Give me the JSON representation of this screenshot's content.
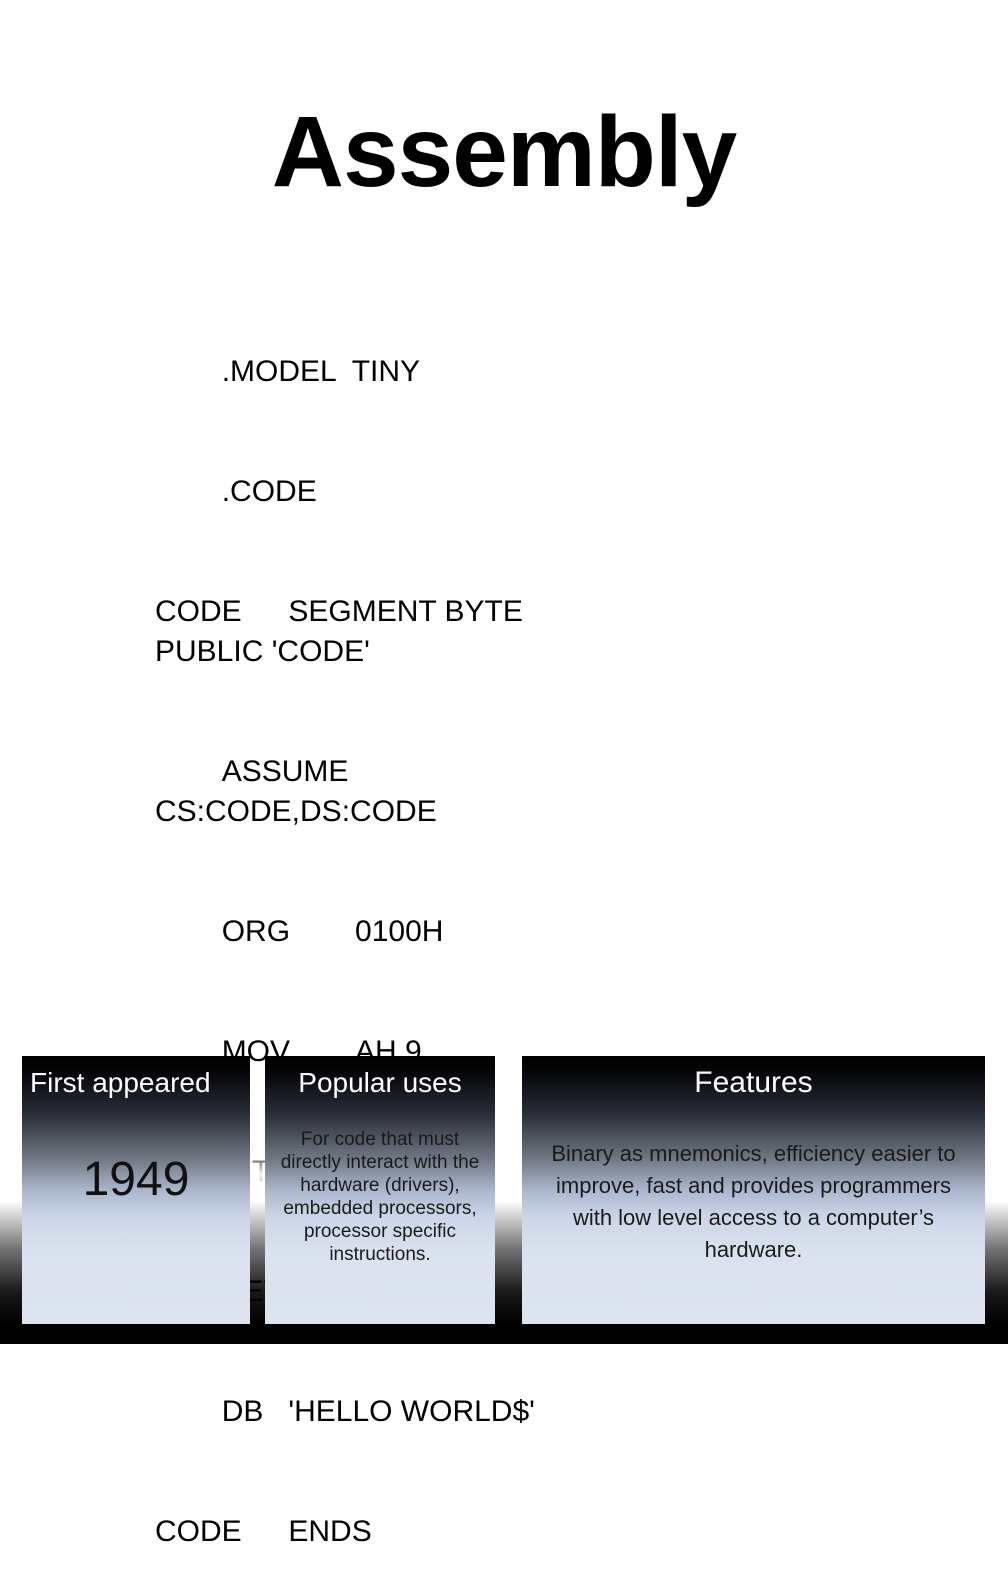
{
  "slide": {
    "title": "Assembly",
    "code_lines": [
      "\t.MODEL  TINY",
      "\t.CODE",
      "CODE\tSEGMENT BYTE PUBLIC 'CODE'",
      "\tASSUME CS:CODE,DS:CODE",
      "\tORG\t0100H",
      "\tMOV\tAH,9",
      "\tINT\t21H",
      "\tRET",
      "\tDB\t'HELLO WORLD$'",
      "CODE\tENDS"
    ],
    "code_text": "          .MODEL  TINY\n          .CODE\nCODE    SEGMENT BYTE PUBLIC 'CODE'\n          ASSUME CS:CODE,DS:CODE\n          ORG    0100H\n          MOV    AH,9\n          INT    21H\n          RET\n          DB    'HELLO WORLD$'\nCODE    ENDS"
  },
  "panels": [
    {
      "header": "First appeared",
      "value": "1949",
      "body": ""
    },
    {
      "header": "Popular uses",
      "value": "",
      "body": "For code that must directly interact with the hardware (drivers), embedded processors, processor specific instructions."
    },
    {
      "header": "Features",
      "value": "",
      "body": "Binary as mnemonics, efficiency easier to improve, fast and provides programmers with low level access to a computer’s hardware."
    }
  ],
  "colors": {
    "page_background": "#ffffff",
    "panel_gradient_top": "#000000",
    "panel_gradient_bottom": "#dde4f0",
    "text_dark": "#000000",
    "text_light": "#ffffff"
  }
}
